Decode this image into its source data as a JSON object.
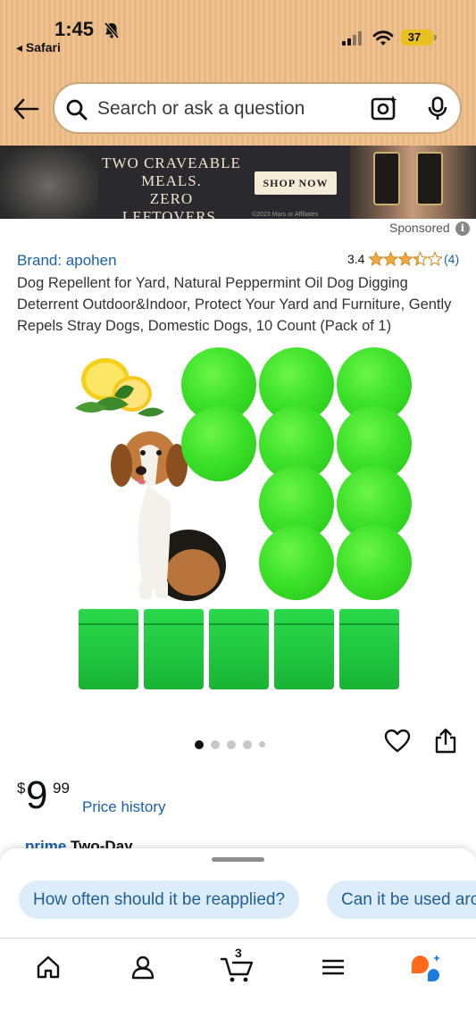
{
  "status_bar": {
    "time": "1:45",
    "back_app": "◂ Safari",
    "battery": "37"
  },
  "search": {
    "placeholder": "Search or ask a question"
  },
  "banner": {
    "line1": "TWO CRAVEABLE",
    "line2": "MEALS.",
    "line3": "ZERO LEFTOVERS.",
    "cta": "SHOP NOW",
    "copyright": "©2023 Mars or Affiliates"
  },
  "sponsored_label": "Sponsored",
  "product": {
    "brand": "Brand: apohen",
    "rating_value": "3.4",
    "rating_count": "(4)",
    "stars": 3.4,
    "title": "Dog Repellent for Yard, Natural Peppermint Oil Dog Digging Deterrent Outdoor&Indoor, Protect Your Yard and Furniture, Gently Repels Stray Dogs, Domestic Dogs, 10 Count (Pack of 1)",
    "price_symbol": "$",
    "price_whole": "9",
    "price_fraction": "99",
    "price_history": "Price history",
    "prime_label": "prime",
    "prime_suffix": "Two-Day"
  },
  "carousel": {
    "count": 5,
    "active": 0
  },
  "suggestions": [
    "How often should it be reapplied?",
    "Can it be used around"
  ],
  "nav": {
    "cart_count": "3"
  },
  "colors": {
    "header_bg": "#efc190",
    "link": "#1b61a8",
    "star": "#f3a847",
    "chip_bg": "#dcecf8",
    "rufus_orange": "#ff6a1a",
    "rufus_blue": "#1b7be0"
  }
}
